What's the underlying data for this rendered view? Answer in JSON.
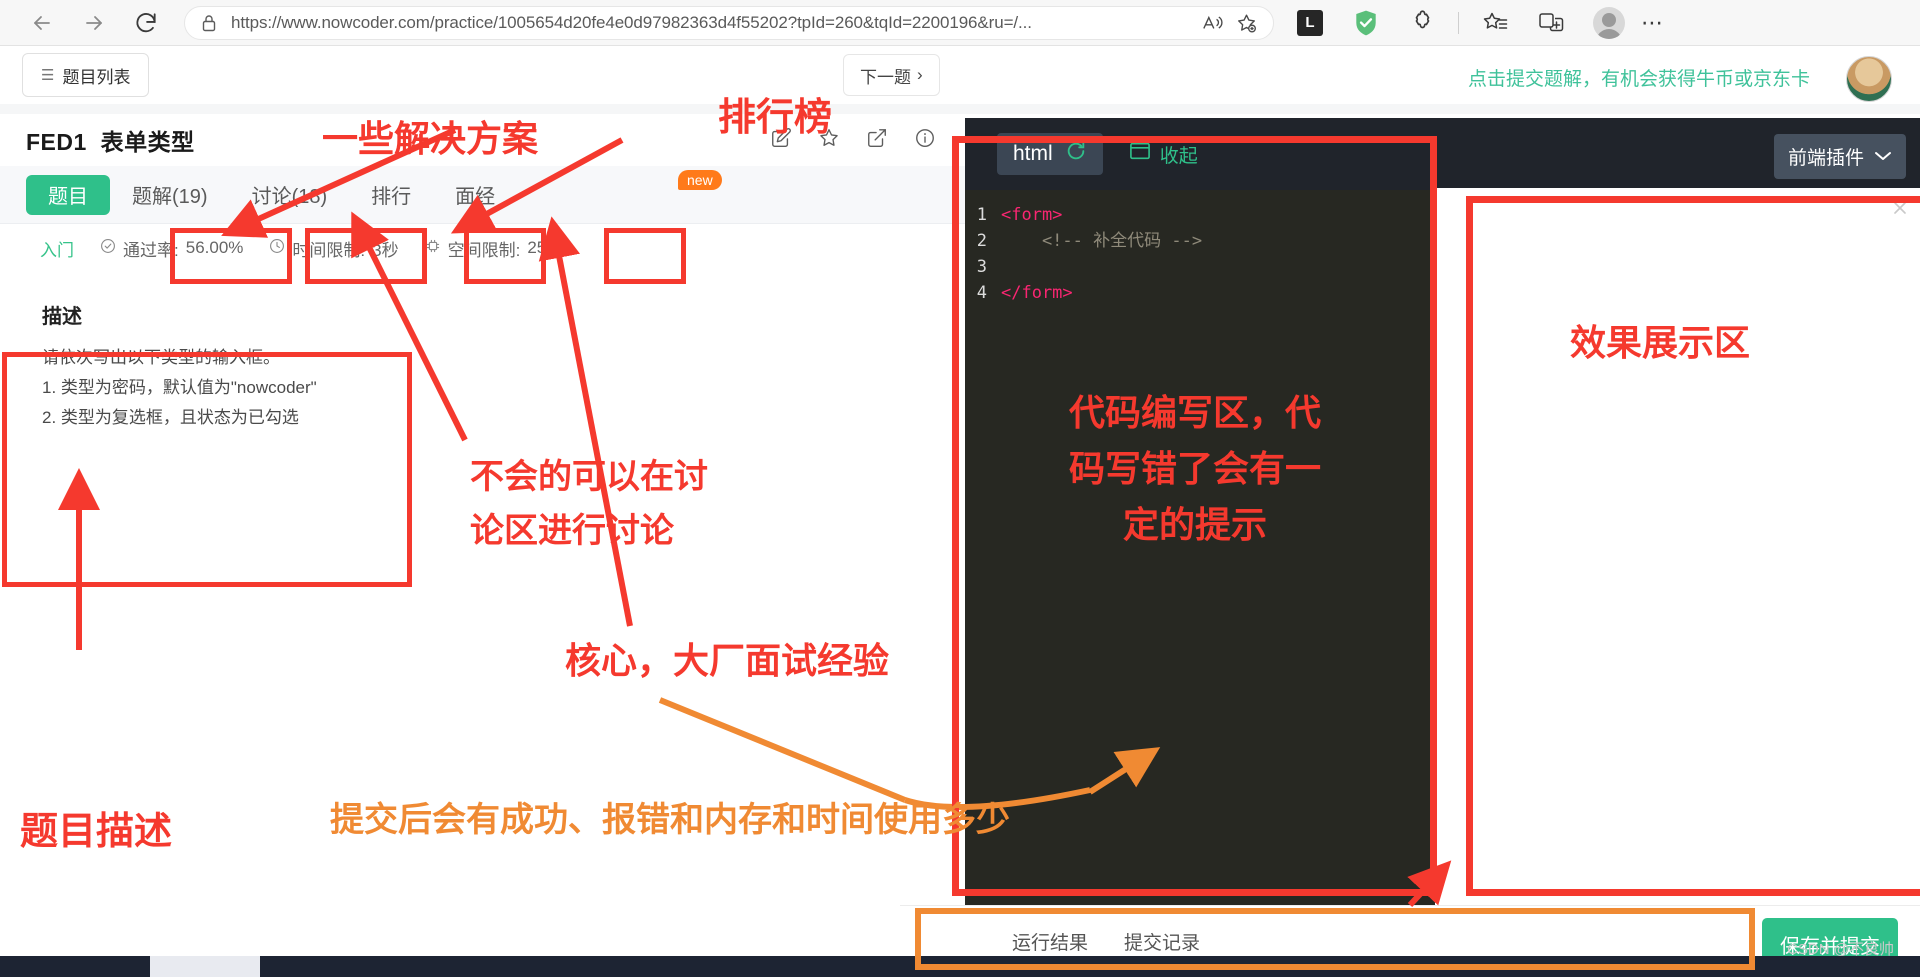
{
  "browser": {
    "url": "https://www.nowcoder.com/practice/1005654d20fe4e0d97982363d4f55202?tpId=260&tqId=2200196&ru=/...",
    "back_label": "back-arrow",
    "forward_label": "forward-arrow",
    "reload_label": "reload",
    "lock_label": "site-info-lock",
    "read_aloud_label": "read-aloud",
    "add_favorite_label": "add-to-favorites",
    "extension_l_label": "L",
    "shield_label": "adblock-shield",
    "puzzle_label": "extensions",
    "collections_label": "collections",
    "split_screen_label": "split-screen",
    "profile_label": "profile",
    "more_label": "⋯"
  },
  "page": {
    "problem_list_button": "题目列表",
    "problem_list_icon": "☰",
    "next_problem_button": "下一题",
    "next_problem_chevron": "›",
    "promo_text": "点击提交题解，有机会获得牛币或京东卡",
    "problem_id": "FED1",
    "problem_title": "表单类型",
    "title_actions": [
      "edit-icon",
      "star-icon",
      "share-icon",
      "info-icon"
    ],
    "tabs": [
      {
        "label": "题目",
        "active": true
      },
      {
        "label": "题解(19)",
        "active": false
      },
      {
        "label": "讨论(18)",
        "active": false
      },
      {
        "label": "排行",
        "active": false
      },
      {
        "label": "面经",
        "active": false
      }
    ],
    "new_badge": "new",
    "meta": {
      "level": "入门",
      "pass_rate_label": "通过率:",
      "pass_rate_value": "56.00%",
      "time_limit_label": "时间限制:",
      "time_limit_value": "3秒",
      "space_limit_label": "空间限制:",
      "space_limit_value": "256M"
    },
    "description": {
      "heading": "描述",
      "lines": [
        "请依次写出以下类型的输入框。",
        "1. 类型为密码，默认值为\"nowcoder\"",
        "2. 类型为复选框，且状态为已勾选"
      ]
    }
  },
  "editor": {
    "language": "html",
    "refresh_icon": "reset-code",
    "collapse_label": "收起",
    "code_lines": [
      {
        "n": "1",
        "text": "<form>",
        "kind": "tag"
      },
      {
        "n": "2",
        "text": "    <!-- 补全代码 -->",
        "kind": "comment"
      },
      {
        "n": "3",
        "text": "",
        "kind": "plain"
      },
      {
        "n": "4",
        "text": "</form>",
        "kind": "tag"
      }
    ]
  },
  "preview": {
    "plugin_button": "前端插件",
    "plugin_chevron": "⌄",
    "close_icon": "✕"
  },
  "bottom": {
    "result_tabs": [
      "运行结果",
      "提交记录"
    ],
    "submit_button": "保存并提交"
  },
  "annotations": [
    {
      "id": "a-solutions",
      "text": "一些解决方案"
    },
    {
      "id": "a-leaderboard",
      "text": "排行榜"
    },
    {
      "id": "a-discussion",
      "text": "不会的可以在讨\n论区进行讨论"
    },
    {
      "id": "a-interview",
      "text": "核心，大厂面试经验"
    },
    {
      "id": "a-desc",
      "text": "题目描述"
    },
    {
      "id": "a-code",
      "text": "代码编写区，代\n码写错了会有一\n定的提示"
    },
    {
      "id": "a-preview",
      "text": "效果展示区"
    },
    {
      "id": "a-submit",
      "text": "提交后会有成功、报错和内存和时间使用多少"
    }
  ],
  "watermark": "CSDN @不良帅"
}
